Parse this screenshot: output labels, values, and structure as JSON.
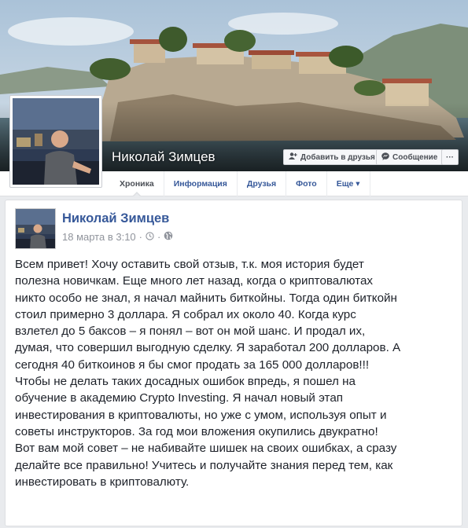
{
  "profile": {
    "name": "Николай Зимцев",
    "add_friend_label": "Добавить в друзья",
    "message_label": "Сообщение",
    "more_label": "···"
  },
  "tabs": [
    {
      "label": "Хроника",
      "active": true
    },
    {
      "label": "Информация",
      "active": false
    },
    {
      "label": "Друзья",
      "active": false
    },
    {
      "label": "Фото",
      "active": false
    },
    {
      "label": "Еще ▾",
      "active": false
    }
  ],
  "post": {
    "author": "Николай Зимцев",
    "date": "18 марта в 3:10",
    "separator": "·",
    "text": "Всем привет! Хочу оставить свой отзыв, т.к. моя история будет\nполезна новичкам. Еще много лет назад, когда о криптовалютах\nникто особо не знал, я начал майнить биткойны. Тогда один биткойн\nстоил примерно 3 доллара. Я собрал их около 40. Когда курс\nвзлетел до 5 баксов – я понял – вот он мой шанс. И продал их,\nдумая, что совершил выгодную сделку. Я заработал 200 долларов. А\nсегодня 40 биткоинов я бы смог продать за 165 000 долларов!!!\nЧтобы не делать таких досадных ошибок впредь, я пошел на\nобучение в академию Crypto Investing. Я начал новый этап\nинвестирования в криптовалюты, но уже с умом, используя опыт и\nсоветы инструкторов. За год мои вложения окупились двукратно!\nВот вам мой совет – не набивайте шишек на своих ошибках, а сразу\nделайте все правильно! Учитесь и получайте знания перед тем, как\nинвестировать в криптовалюту."
  },
  "colors": {
    "link": "#365899",
    "meta": "#90949c",
    "text": "#1d2129",
    "background": "#e9ebee"
  }
}
